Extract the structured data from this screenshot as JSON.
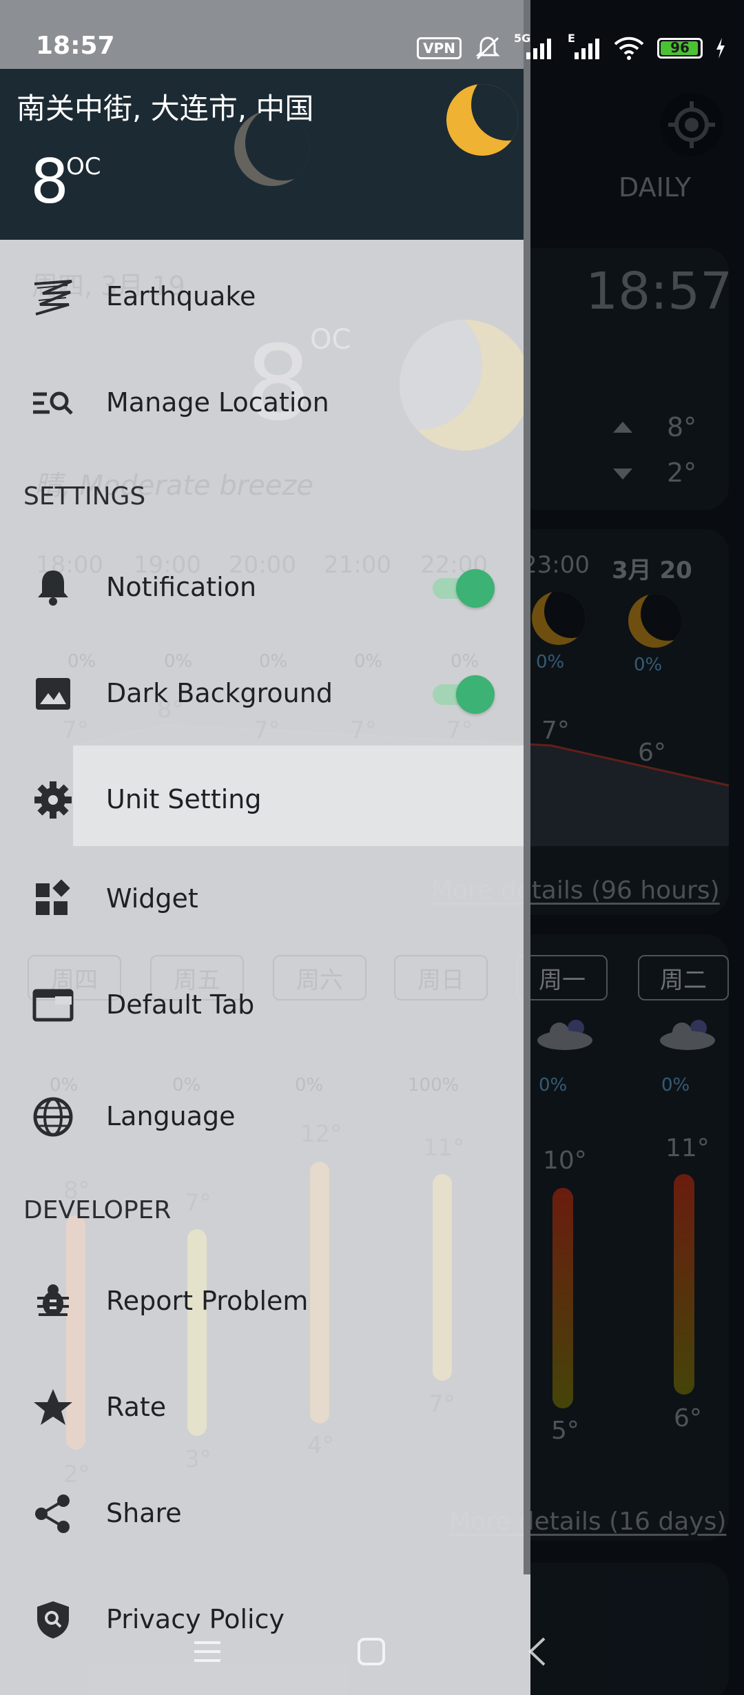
{
  "status_bar": {
    "time": "18:57",
    "vpn": "VPN",
    "network": "5G",
    "network2": "E",
    "battery": "96",
    "battery_level": 0.96
  },
  "weather_bg": {
    "tab": "DAILY",
    "clock": "18:57",
    "date": "周四, 3月 19",
    "current_temp": "8",
    "temp_unit": "OC",
    "condition": "晴, Moderate breeze",
    "high": "8°",
    "low": "2°",
    "hourly": [
      {
        "label": "18:00",
        "rain": "0%",
        "temp": "7°"
      },
      {
        "label": "19:00",
        "rain": "0%",
        "temp": "8°"
      },
      {
        "label": "20:00",
        "rain": "0%",
        "temp": "7°"
      },
      {
        "label": "21:00",
        "rain": "0%",
        "temp": "7°"
      },
      {
        "label": "22:00",
        "rain": "0%",
        "temp": "7°"
      },
      {
        "label": "23:00",
        "rain": "0%",
        "temp": "7°"
      },
      {
        "label": "3月 20",
        "rain": "0%",
        "temp": "6°"
      }
    ],
    "hourly_more": "More details (96 hours)",
    "daily": [
      {
        "label": "周四",
        "rain": "0%",
        "high": "8°",
        "low": "2°"
      },
      {
        "label": "周五",
        "rain": "0%",
        "high": "7°",
        "low": "3°"
      },
      {
        "label": "周六",
        "rain": "0%",
        "high": "12°",
        "low": "4°"
      },
      {
        "label": "周日",
        "rain": "100%",
        "high": "11°",
        "low": "7°"
      },
      {
        "label": "周一",
        "rain": "0%",
        "high": "10°",
        "low": "5°"
      },
      {
        "label": "周二",
        "rain": "0%",
        "high": "11°",
        "low": "6°"
      }
    ],
    "daily_more": "More details (16 days)"
  },
  "drawer": {
    "location": "南关中街, 大连市, 中国",
    "temp": "8",
    "temp_unit": "OC",
    "items": [
      {
        "label": "Earthquake",
        "icon": "earthquake-icon"
      },
      {
        "label": "Manage Location",
        "icon": "manage-location-icon"
      }
    ],
    "settings_title": "SETTINGS",
    "settings": [
      {
        "label": "Notification",
        "icon": "bell-icon",
        "toggle": true
      },
      {
        "label": "Dark Background",
        "icon": "image-icon",
        "toggle": true
      },
      {
        "label": "Unit Setting",
        "icon": "gear-icon"
      },
      {
        "label": "Widget",
        "icon": "widget-icon"
      },
      {
        "label": "Default Tab",
        "icon": "tab-icon"
      },
      {
        "label": "Language",
        "icon": "globe-icon"
      }
    ],
    "developer_title": "DEVELOPER",
    "developer": [
      {
        "label": "Report Problem",
        "icon": "bug-icon"
      },
      {
        "label": "Rate",
        "icon": "star-icon"
      },
      {
        "label": "Share",
        "icon": "share-icon"
      },
      {
        "label": "Privacy Policy",
        "icon": "privacy-shield-icon"
      }
    ]
  },
  "colors": {
    "toggle_on": "#3cb274",
    "moon": "#f0b232",
    "drawer_bg": "#d7d9dc",
    "header_bg": "#1c2a33"
  }
}
